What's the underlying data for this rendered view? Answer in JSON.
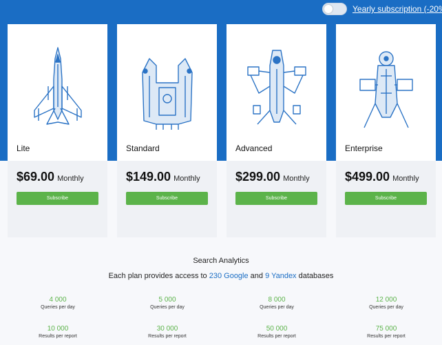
{
  "header": {
    "toggle_state": "off",
    "yearly_label": "Yearly subscription (-20%)"
  },
  "plans": [
    {
      "name": "Lite",
      "price": "$69.00",
      "period": "Monthly",
      "subscribe_label": "Subscribe",
      "icon": "jet-fighter-icon"
    },
    {
      "name": "Standard",
      "price": "$149.00",
      "period": "Monthly",
      "subscribe_label": "Subscribe",
      "icon": "heavy-starship-icon"
    },
    {
      "name": "Advanced",
      "price": "$299.00",
      "period": "Monthly",
      "subscribe_label": "Subscribe",
      "icon": "gunship-icon"
    },
    {
      "name": "Enterprise",
      "price": "$499.00",
      "period": "Monthly",
      "subscribe_label": "Subscribe",
      "icon": "cruiser-ship-icon"
    }
  ],
  "analytics": {
    "title": "Search Analytics",
    "desc_before": "Each plan provides access to ",
    "google": "230 Google",
    "desc_and": " and ",
    "yandex": "9 Yandex",
    "desc_after": " databases"
  },
  "stats": {
    "queries": [
      {
        "value": "4 000",
        "label": "Queries per day"
      },
      {
        "value": "5 000",
        "label": "Queries per day"
      },
      {
        "value": "8 000",
        "label": "Queries per day"
      },
      {
        "value": "12 000",
        "label": "Queries per day"
      }
    ],
    "results": [
      {
        "value": "10 000",
        "label": "Results per report"
      },
      {
        "value": "30 000",
        "label": "Results per report"
      },
      {
        "value": "50 000",
        "label": "Results per report"
      },
      {
        "value": "75 000",
        "label": "Results per report"
      }
    ]
  },
  "colors": {
    "brand_blue": "#1a6dc4",
    "subscribe_green": "#5cb34a",
    "card_gray": "#eff1f5"
  }
}
